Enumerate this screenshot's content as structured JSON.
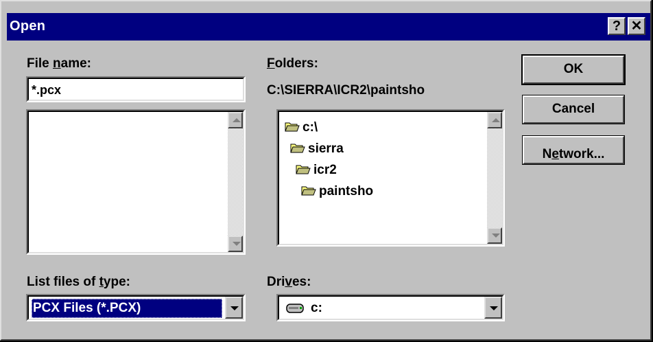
{
  "dialog": {
    "title": "Open",
    "help_glyph": "?",
    "close_glyph": "✕"
  },
  "file_name": {
    "label_prefix": "File ",
    "label_accel": "n",
    "label_suffix": "ame:",
    "value": "*.pcx",
    "files": []
  },
  "folders": {
    "label_accel": "F",
    "label_suffix": "olders:",
    "current_path": "C:\\SIERRA\\ICR2\\paintsho",
    "tree": [
      {
        "name": "c:\\",
        "icon": "open-folder-icon"
      },
      {
        "name": "sierra",
        "icon": "open-folder-icon"
      },
      {
        "name": "icr2",
        "icon": "open-folder-icon"
      },
      {
        "name": "paintsho",
        "icon": "open-folder-icon"
      }
    ]
  },
  "file_type": {
    "label_prefix": "List files of ",
    "label_accel": "t",
    "label_suffix": "ype:",
    "selected": "PCX Files (*.PCX)"
  },
  "drives": {
    "label_prefix": "Dri",
    "label_accel": "v",
    "label_suffix": "es:",
    "selected": "c:",
    "icon": "drive-icon"
  },
  "buttons": {
    "ok": "OK",
    "cancel": "Cancel",
    "network_prefix": "N",
    "network_accel": "e",
    "network_suffix": "twork..."
  },
  "colors": {
    "title_bar": "#000080",
    "face": "#c0c0c0",
    "selection": "#000080"
  }
}
